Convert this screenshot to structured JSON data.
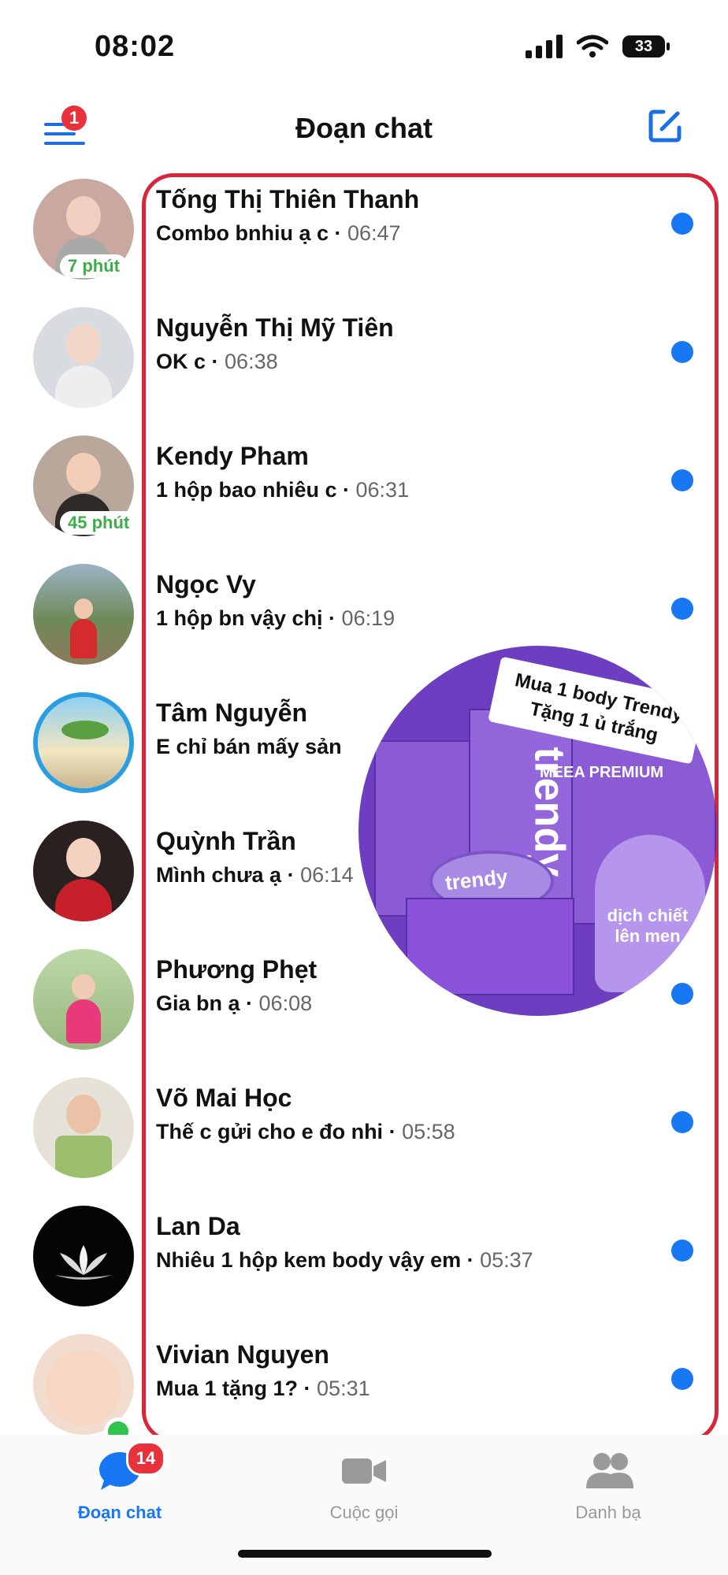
{
  "status_bar": {
    "time": "08:02",
    "battery": "33"
  },
  "header": {
    "title": "Đoạn chat",
    "menu_badge": "1"
  },
  "chats": [
    {
      "name": "Tống Thị Thiên Thanh",
      "preview": "Combo bnhiu ạ c",
      "time": "06:47",
      "active_badge": "7 phút"
    },
    {
      "name": "Nguyễn Thị Mỹ Tiên",
      "preview": "OK c",
      "time": "06:38"
    },
    {
      "name": "Kendy Pham",
      "preview": "1 hộp bao nhiêu c",
      "time": "06:31",
      "active_badge": "45 phút"
    },
    {
      "name": "Ngọc Vy",
      "preview": "1 hộp bn vậy chị",
      "time": "06:19"
    },
    {
      "name": "Tâm Nguyễn",
      "preview": "E chỉ bán mấy sản",
      "time": ""
    },
    {
      "name": "Quỳnh Trần",
      "preview": "Mình chưa ạ",
      "time": "06:14"
    },
    {
      "name": "Phương Phẹt",
      "preview": "Gia bn ạ",
      "time": "06:08"
    },
    {
      "name": "Võ Mai Học",
      "preview": "Thế c gửi cho e đo nhi",
      "time": "05:58"
    },
    {
      "name": "Lan Da",
      "preview": "Nhiêu 1 hộp kem body vậy em",
      "time": "05:37"
    },
    {
      "name": "Vivian Nguyen",
      "preview": "Mua 1 tặng 1?",
      "time": "05:31"
    }
  ],
  "ad": {
    "caption": "Mua 1 body Trendy Tặng 1 ủ trắng",
    "brand": "trendy",
    "product_text": "dịch chiết lên men",
    "maker": "MEEA PREMIUM"
  },
  "tabs": [
    {
      "label": "Đoạn chat",
      "badge": "14",
      "icon": "chat-bubble-icon"
    },
    {
      "label": "Cuộc gọi",
      "icon": "video-call-icon"
    },
    {
      "label": "Danh bạ",
      "icon": "contacts-icon"
    }
  ],
  "colors": {
    "accent": "#1877f2",
    "badge": "#e8313b",
    "highlight": "#d9253a",
    "online": "#31c24b"
  }
}
